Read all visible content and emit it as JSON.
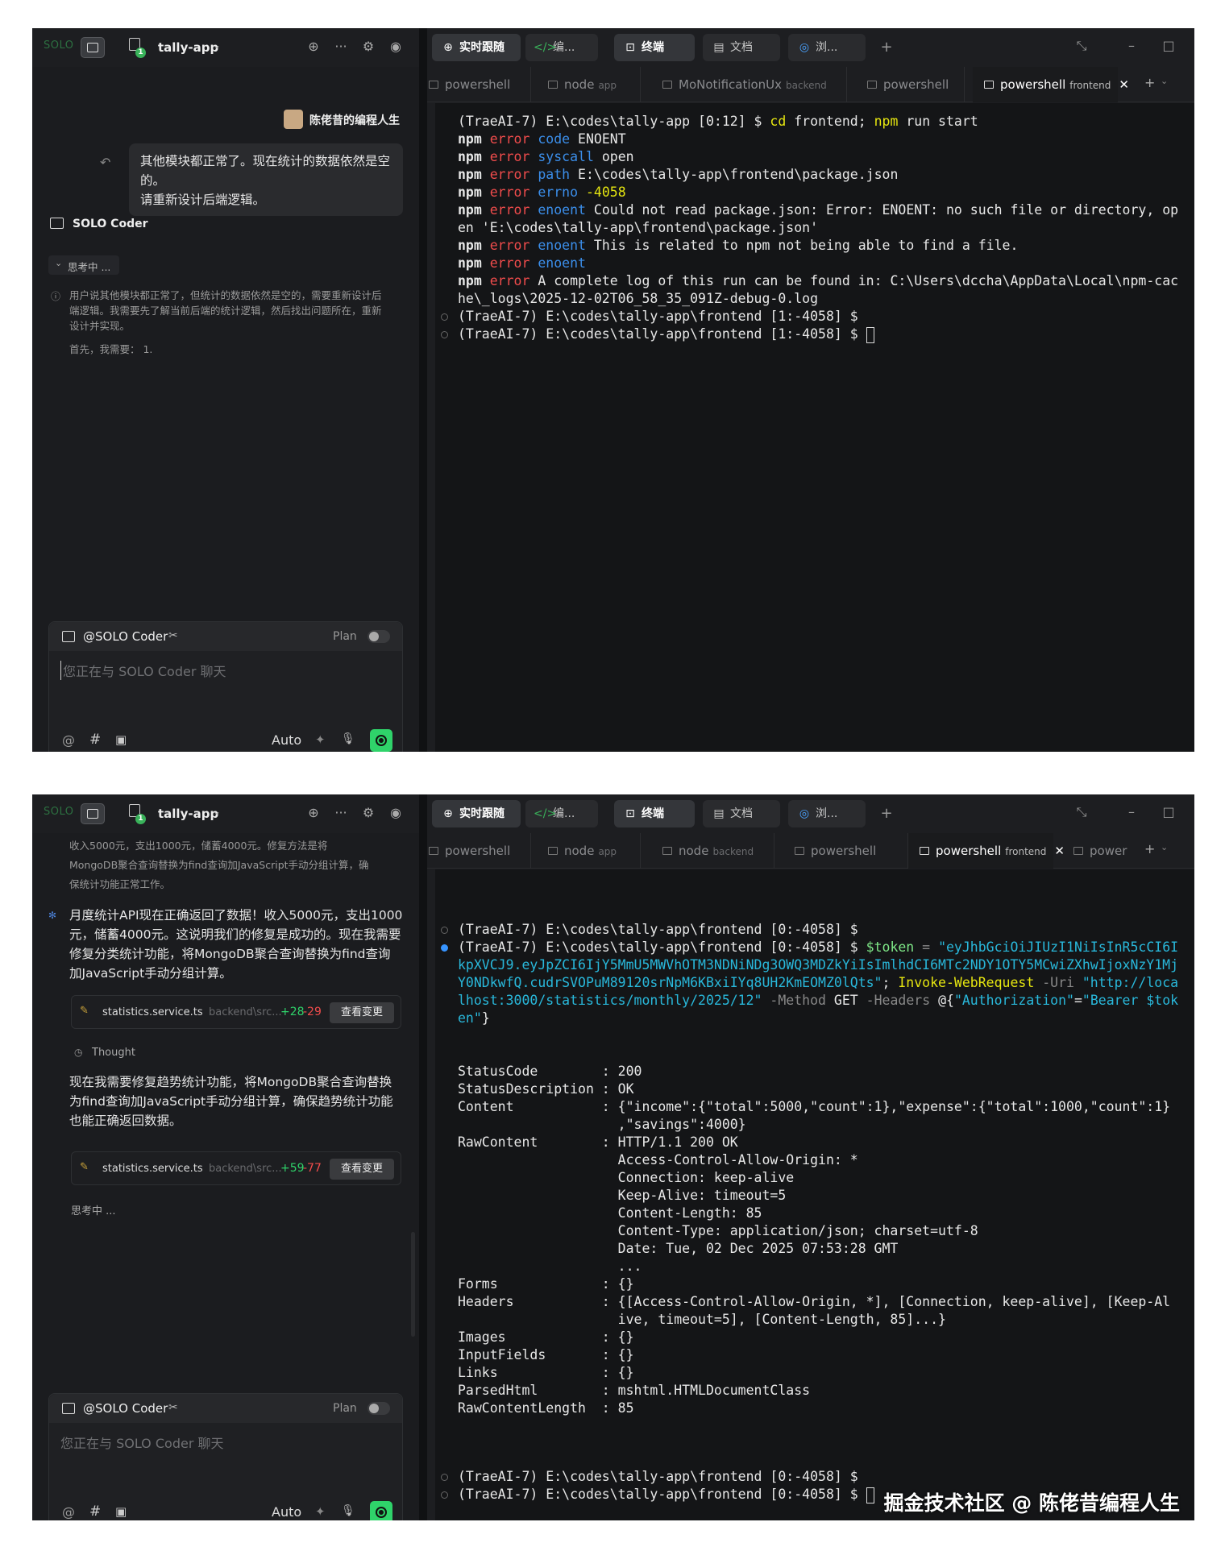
{
  "app": {
    "solo_label": "SOLO",
    "project": "tally-app",
    "project_badge": "1",
    "tabs": [
      "实时跟随",
      "编...",
      "终端",
      "文档",
      "浏..."
    ],
    "active_tab": "终端"
  },
  "colors": {
    "accent": "#2fd36a",
    "error_red": "#f14c4c",
    "blue": "#3b8eea",
    "yellow": "#e5e510"
  },
  "screen1": {
    "user_name": "陈佬昔的编程人生",
    "user_message_line1": "其他模块都正常了。现在统计的数据依然是空",
    "user_message_line2": "的。",
    "user_message_line3": "请重新设计后端逻辑。",
    "assistant_name": "SOLO Coder",
    "thinking_label": "思考中 ...",
    "thinking_line1": "用户说其他模块都正常了，但统计的数据依然是空的，需要重新设计后",
    "thinking_line2": "端逻辑。我需要先了解当前后端的统计逻辑，然后找出问题所在，重新",
    "thinking_line3": "设计并实现。",
    "thinking_line4": "首先，我需要： 1.",
    "terminal_tabs": [
      {
        "name": "powershell",
        "sub": ""
      },
      {
        "name": "node",
        "sub": "app"
      },
      {
        "name": "MoNotificationUx",
        "sub": "backend"
      },
      {
        "name": "powershell",
        "sub": ""
      },
      {
        "name": "powershell",
        "sub": "frontend"
      }
    ],
    "term": {
      "l1": "(TraeAI-7) E:\\codes\\tally-app [0:12] $ ",
      "l1_cd": "cd",
      "l1_arg": " frontend; ",
      "l1_npm": "npm",
      "l1_rest": " run start",
      "npm": "npm",
      "error": "error",
      "e1k": "code",
      "e1v": " ENOENT",
      "e2k": "syscall",
      "e2v": " open",
      "e3k": "path",
      "e3v": " E:\\codes\\tally-app\\frontend\\package.json",
      "e4k": "errno",
      "e4v": " -4058",
      "e5k": "enoent",
      "e5v": " Could not read package.json: Error: ENOENT: no such file or directory, op",
      "e5w": "en 'E:\\codes\\tally-app\\frontend\\package.json'",
      "e6k": "enoent",
      "e6v": " This is related to npm not being able to find a file.",
      "e7k": "enoent",
      "e8v": " A complete log of this run can be found in: C:\\Users\\dccha\\AppData\\Local\\npm-cac",
      "e8w": "he\\_logs\\2025-12-02T06_58_35_091Z-debug-0.log",
      "p1": "(TraeAI-7) E:\\codes\\tally-app\\frontend [1:-4058] $",
      "p2": "(TraeAI-7) E:\\codes\\tally-app\\frontend [1:-4058] $ "
    }
  },
  "chat": {
    "mention": "@SOLO Coder",
    "plan": "Plan",
    "placeholder": "您正在与 SOLO Coder 聊天",
    "mode": "Auto"
  },
  "screen2": {
    "top_text1": "收入5000元，支出1000元，储蓄4000元。修复方法是将",
    "top_text2": "MongoDB聚合查询替换为find查询加JavaScript手动分组计算，确",
    "top_text3": "保统计功能正常工作。",
    "msg1_l1": "月度统计API现在正确返回了数据！收入5000元，支出1000",
    "msg1_l2": "元，储蓄4000元。这说明我们的修复是成功的。现在我需要",
    "msg1_l3": "修复分类统计功能，将MongoDB聚合查询替换为find查询",
    "msg1_l4": "加JavaScript手动分组计算。",
    "file1": {
      "name": "statistics.service.ts",
      "path": "backend\\src...",
      "add": "+28",
      "del": "-29",
      "btn": "查看变更"
    },
    "thought": "Thought",
    "msg2_l1": "现在我需要修复趋势统计功能，将MongoDB聚合查询替换",
    "msg2_l2": "为find查询加JavaScript手动分组计算，确保趋势统计功能",
    "msg2_l3": "也能正确返回数据。",
    "file2": {
      "name": "statistics.service.ts",
      "path": "backend\\src...",
      "add": "+59",
      "del": "-77",
      "btn": "查看变更"
    },
    "thinking": "思考中 ...",
    "terminal_tabs": [
      {
        "name": "powershell",
        "sub": ""
      },
      {
        "name": "node",
        "sub": "app"
      },
      {
        "name": "node",
        "sub": "backend"
      },
      {
        "name": "powershell",
        "sub": ""
      },
      {
        "name": "powershell",
        "sub": "frontend"
      },
      {
        "name": "power",
        "sub": ""
      }
    ],
    "term": {
      "p0": "(TraeAI-7) E:\\codes\\tally-app\\frontend [0:-4058] $",
      "p1": "(TraeAI-7) E:\\codes\\tally-app\\frontend [0:-4058] $ ",
      "tok_var": "$token",
      "tok_eq": " = ",
      "tok1": "\"eyJhbGciOiJIUzI1NiIsInR5cCI6I",
      "tok2": "kpXVCJ9.eyJpZCI6IjY5MmU5MWVhOTM3NDNiNDg3OWQ3MDZkYiIsImlhdCI6MTc2NDY1OTY5MCwiZXhwIjoxNzY1Mj",
      "tok3": "Y0NDkwfQ.cudrSVOPuM89120srNpM6KBxiIYq8UH2KmEOMZ0lQts\"",
      "semi": "; ",
      "iwr": "Invoke-WebRequest",
      "uri_flag": " -Uri ",
      "uri1": "\"http://loca",
      "uri2": "lhost:3000/statistics/monthly/2025/12\"",
      "method_flag": " -Method ",
      "method": "GET",
      "headers_flag": " -Headers ",
      "hdr_open": "@{",
      "hdr_key": "\"Authorization\"",
      "hdr_eq": "=",
      "hdr_val1": "\"Bearer $tok",
      "hdr_val2": "en\"",
      "hdr_close": "}",
      "r1": "StatusCode        : 200",
      "r2": "StatusDescription : OK",
      "r3": "Content           : {\"income\":{\"total\":5000,\"count\":1},\"expense\":{\"total\":1000,\"count\":1}",
      "r4": "                    ,\"savings\":4000}",
      "r5": "RawContent        : HTTP/1.1 200 OK",
      "r6": "                    Access-Control-Allow-Origin: *",
      "r7": "                    Connection: keep-alive",
      "r8": "                    Keep-Alive: timeout=5",
      "r9": "                    Content-Length: 85",
      "r10": "                    Content-Type: application/json; charset=utf-8",
      "r11": "                    Date: Tue, 02 Dec 2025 07:53:28 GMT",
      "r12": "                    ...",
      "r13": "Forms             : {}",
      "r14": "Headers           : {[Access-Control-Allow-Origin, *], [Connection, keep-alive], [Keep-Al",
      "r15": "                    ive, timeout=5], [Content-Length, 85]...}",
      "r16": "Images            : {}",
      "r17": "InputFields       : {}",
      "r18": "Links             : {}",
      "r19": "ParsedHtml        : mshtml.HTMLDocumentClass",
      "r20": "RawContentLength  : 85",
      "p2": "(TraeAI-7) E:\\codes\\tally-app\\frontend [0:-4058] $",
      "p3": "(TraeAI-7) E:\\codes\\tally-app\\frontend [0:-4058] $ "
    },
    "watermark": "掘金技术社区 @ 陈佬昔编程人生"
  }
}
